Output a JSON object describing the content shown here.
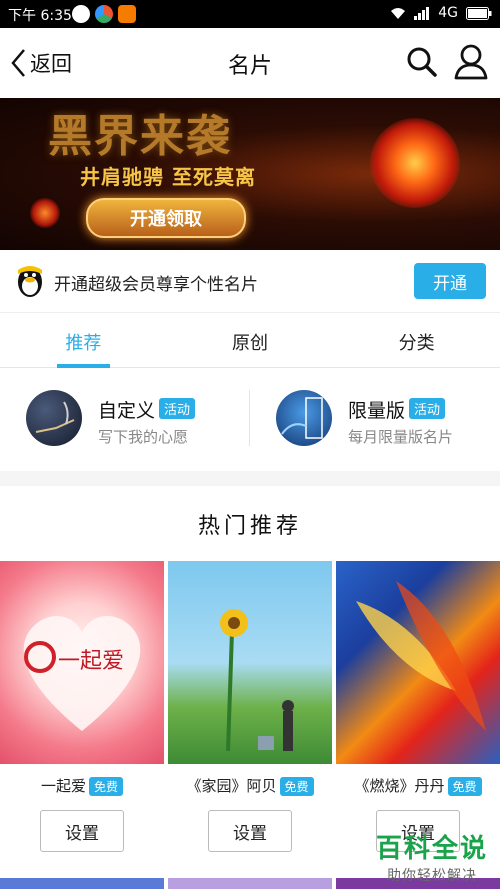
{
  "status_bar": {
    "time": "下午 6:35",
    "network": "4G"
  },
  "nav": {
    "back_label": "返回",
    "title": "名片"
  },
  "banner": {
    "title": "黑界来袭",
    "subtitle": "井肩驰骋 至死莫离",
    "button_label": "开通领取",
    "dot_count": 7,
    "active_dot": 4
  },
  "vip": {
    "text": "开通超级会员尊享个性名片",
    "button_label": "开通"
  },
  "tabs": [
    {
      "label": "推荐",
      "active": true
    },
    {
      "label": "原创",
      "active": false
    },
    {
      "label": "分类",
      "active": false
    }
  ],
  "features": [
    {
      "name": "自定义",
      "badge": "活动",
      "desc": "写下我的心愿"
    },
    {
      "name": "限量版",
      "badge": "活动",
      "desc": "每月限量版名片"
    }
  ],
  "hot": {
    "title": "热门推荐",
    "cards": [
      {
        "name": "一起爱",
        "badge": "免费",
        "button": "设置",
        "thumb_text": "一起爱"
      },
      {
        "name": "《家园》阿贝",
        "badge": "免费",
        "button": "设置"
      },
      {
        "name": "《燃烧》丹丹",
        "badge": "免费",
        "button": "设置"
      }
    ]
  },
  "watermark": {
    "line1": "百科全说",
    "line2": "助你轻松解决"
  },
  "colors": {
    "accent": "#2aaee7",
    "watermark_green": "#1aa34a"
  }
}
